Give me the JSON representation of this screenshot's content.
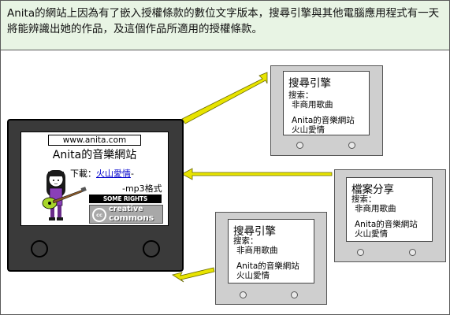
{
  "header": {
    "text": "Anita的網站上因為有了嵌入授權條款的數位文字版本，搜尋引擎與其他電腦應用程式有一天將能辨識出她的作品，及這個作品所適用的授權條款。"
  },
  "main_device": {
    "url": "www.anita.com",
    "site_title": "Anita的音樂網站",
    "download_label": "下載：",
    "song_link": "火山愛情",
    "dash": "-",
    "format": "-mp3格式",
    "some_rights": "SOME RIGHTS RESERVED",
    "cc_symbol": "cc",
    "cc_word1": "creative",
    "cc_word2": "commons"
  },
  "devices": [
    {
      "title": "搜尋引擎",
      "search_label": "搜索：",
      "license": "非商用歌曲",
      "site": "Anita的音樂網站",
      "song": "火山愛情"
    },
    {
      "title": "檔案分享",
      "search_label": "搜索：",
      "license": "非商用歌曲",
      "site": "Anita的音樂網站",
      "song": "火山愛情"
    },
    {
      "title": "搜尋引擎",
      "search_label": "搜索：",
      "license": "非商用歌曲",
      "site": "Anita的音樂網站",
      "song": "火山愛情"
    }
  ],
  "colors": {
    "header_bg": "#e8f4e4",
    "arrow": "#e8e400",
    "device_grey": "#cfcfcf",
    "main_device": "#3a3a3a",
    "link": "#0000cc"
  }
}
